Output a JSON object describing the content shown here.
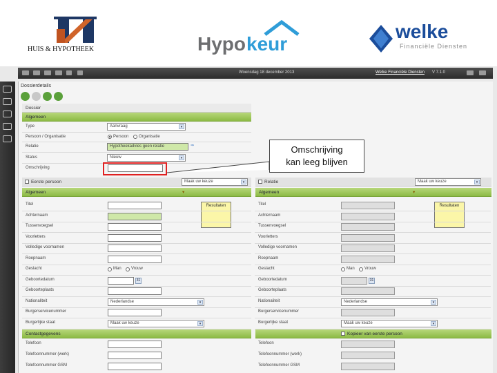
{
  "logos": {
    "huis_text": "HUIS & HYPOTHEEK",
    "hypo_part1": "Hypo",
    "hypo_part2": "keur",
    "welke_name": "welke",
    "welke_sub": "Financiële Diensten"
  },
  "topbar": {
    "date": "Woensdag 18 december 2013",
    "company": "Welke Financiële Diensten",
    "version": "V 7.1.0"
  },
  "panel": {
    "title": "Dossierdetails",
    "section_dossier": "Dossier",
    "section_algemeen": "Algemeen",
    "rows": [
      {
        "label": "Type",
        "value": "Aanvraag"
      },
      {
        "label": "Persoon / Organisatie",
        "opt1": "Persoon",
        "opt2": "Organisatie"
      },
      {
        "label": "Relatie",
        "value": "Hypotheekadvies geen relatie"
      },
      {
        "label": "Status",
        "value": "Nieuw"
      },
      {
        "label": "Omschrijving",
        "value": ""
      }
    ]
  },
  "callout": {
    "line1": "Omschrijving",
    "line2": "kan leeg blijven"
  },
  "left_person": {
    "header": "Eerste persoon",
    "select": "Maak uw keuze",
    "section": "Algemeen",
    "result_label": "Resultaten",
    "fields": [
      "Titel",
      "Achternaam",
      "Tussenvoegsel",
      "Voorletters",
      "Volledige voornamen",
      "Roepnaam",
      "Geslacht",
      "Geboortedatum",
      "Geboorteplaats",
      "Nationaliteit",
      "Burgerservicenummer",
      "Burgerlijke staat"
    ],
    "gender_m": "Man",
    "gender_f": "Vrouw",
    "nationality": "Nederlandse",
    "civil_status": "Maak uw keuze",
    "contact_section": "Contactgegevens",
    "contact_fields": [
      "Telefoon",
      "Telefoonnummer (werk)",
      "Telefoonnummer GSM"
    ]
  },
  "right_person": {
    "header": "Relatie",
    "select": "Maak uw keuze",
    "section": "Algemeen",
    "result_label": "Resultaten",
    "fields": [
      "Titel",
      "Achternaam",
      "Tussenvoegsel",
      "Voorletters",
      "Volledige voornamen",
      "Roepnaam",
      "Geslacht",
      "Geboortedatum",
      "Geboorteplaats",
      "Nationaliteit",
      "Burgerservicenummer",
      "Burgerlijke staat"
    ],
    "gender_m": "Man",
    "gender_f": "Vrouw",
    "nationality": "Nederlandse",
    "civil_status": "Maak uw keuze",
    "contact_section": "Kopieer van eerste persoon",
    "contact_fields": [
      "Telefoon",
      "Telefoonnummer (werk)",
      "Telefoonnummer GSM"
    ]
  },
  "colors": {
    "green": "#8cba45",
    "highlight": "#e02020",
    "result": "#fbf6a8"
  }
}
